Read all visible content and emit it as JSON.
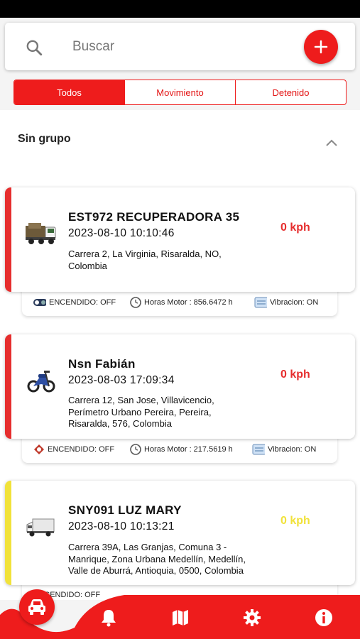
{
  "search": {
    "placeholder": "Buscar"
  },
  "tabs": [
    {
      "label": "Todos",
      "active": true
    },
    {
      "label": "Movimiento",
      "active": false
    },
    {
      "label": "Detenido",
      "active": false
    }
  ],
  "group": {
    "title": "Sin grupo"
  },
  "vehicles": [
    {
      "name": "EST972 RECUPERADORA  35",
      "datetime": "2023-08-10 10:10:46",
      "address": "Carrera 2, La Virginia, Risaralda, NO, Colombia",
      "speed": "0 kph",
      "status_color": "#e62e2e",
      "speed_color": "#e62e2e",
      "icon": "truck-icon",
      "ignition": "ENCENDIDO: OFF",
      "engine_hours": "Horas Motor : 856.6472 h",
      "vibration": "Vibracion: ON"
    },
    {
      "name": "Nsn Fabián",
      "datetime": "2023-08-03 17:09:34",
      "address": "Carrera 12, San Jose, Villavicencio, Perímetro Urbano Pereira, Pereira, Risaralda, 576, Colombia",
      "speed": "0 kph",
      "status_color": "#e62e2e",
      "speed_color": "#e62e2e",
      "icon": "motorcycle-icon",
      "ignition": "ENCENDIDO: OFF",
      "engine_hours": "Horas Motor : 217.5619 h",
      "vibration": "Vibracion: ON"
    },
    {
      "name": "SNY091 LUZ MARY",
      "datetime": "2023-08-10 10:13:21",
      "address": "Carrera 39A, Las Granjas, Comuna 3 - Manrique, Zona Urbana Medellín, Medellín, Valle de Aburrá, Antioquia, 0500, Colombia",
      "speed": "0 kph",
      "status_color": "#f1e23a",
      "speed_color": "#f1e23a",
      "icon": "van-icon",
      "ignition": "ENCENDIDO: OFF"
    }
  ],
  "nav": {
    "items": [
      "car-icon",
      "bell-icon",
      "map-icon",
      "gear-icon",
      "info-icon"
    ],
    "accent": "#ee1c1c"
  }
}
